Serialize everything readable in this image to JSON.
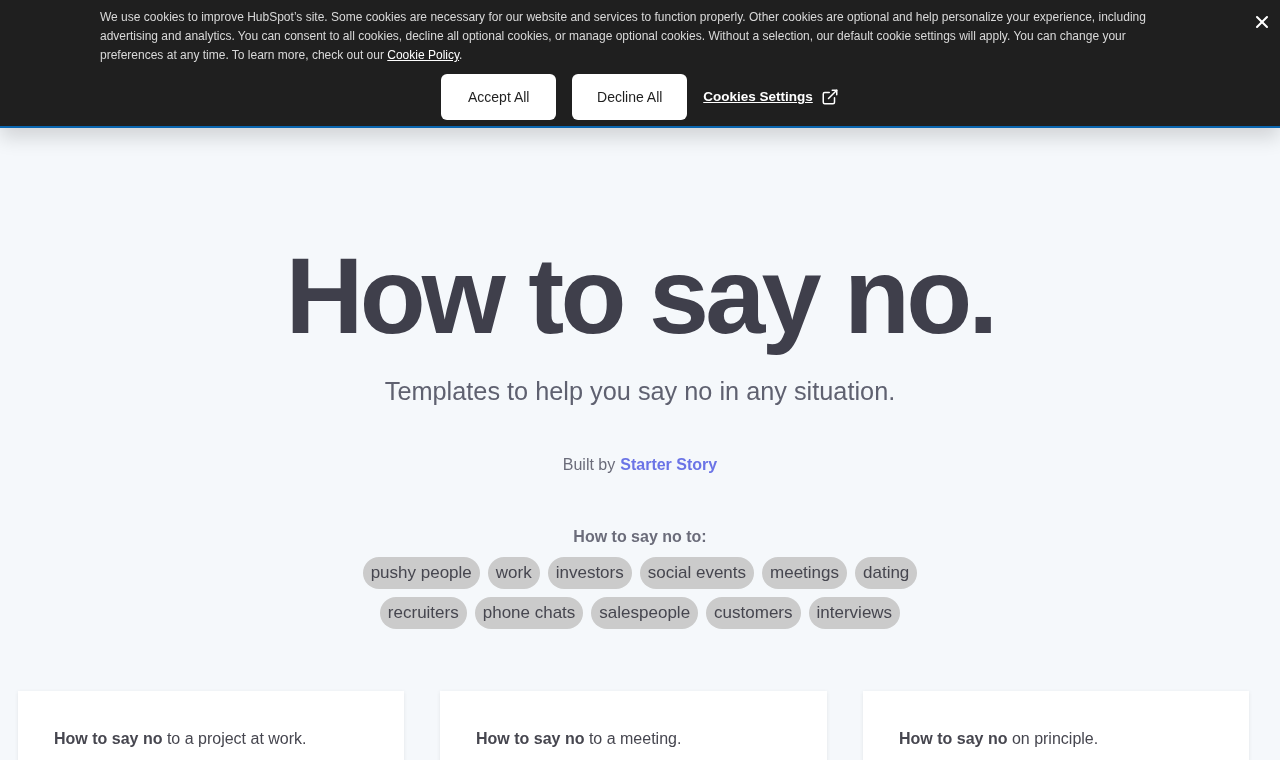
{
  "cookie_banner": {
    "message": "We use cookies to improve HubSpot’s site. Some cookies are necessary for our website and services to function properly. Other cookies are optional and help personalize your experience, including advertising and analytics. You can consent to all cookies, decline all optional cookies, or manage optional cookies. Without a selection, our default cookie settings will apply. You can change your preferences at any time. To learn more, check out our",
    "policy_link": "Cookie Policy",
    "message_end": ".",
    "buttons": [
      "Accept All",
      "Decline All"
    ],
    "settings_link": "Cookies Settings"
  },
  "hero": {
    "title": "How to say no.",
    "subtitle": "Templates to help you say no in any situation.",
    "credit_prefix": "Built by",
    "credit_link": "Starter Story"
  },
  "topics": {
    "heading": "How to say no to:",
    "rows": [
      [
        "pushy people",
        "work",
        "investors",
        "social events",
        "meetings",
        "dating"
      ],
      [
        "recruiters",
        "phone chats",
        "salespeople",
        "customers",
        "interviews"
      ]
    ]
  },
  "cards": [
    {
      "text": "**How to say no** to a project at work."
    },
    {
      "text": "**How to say no** to a meeting."
    },
    {
      "text": "**How to say no** on principle."
    }
  ]
}
